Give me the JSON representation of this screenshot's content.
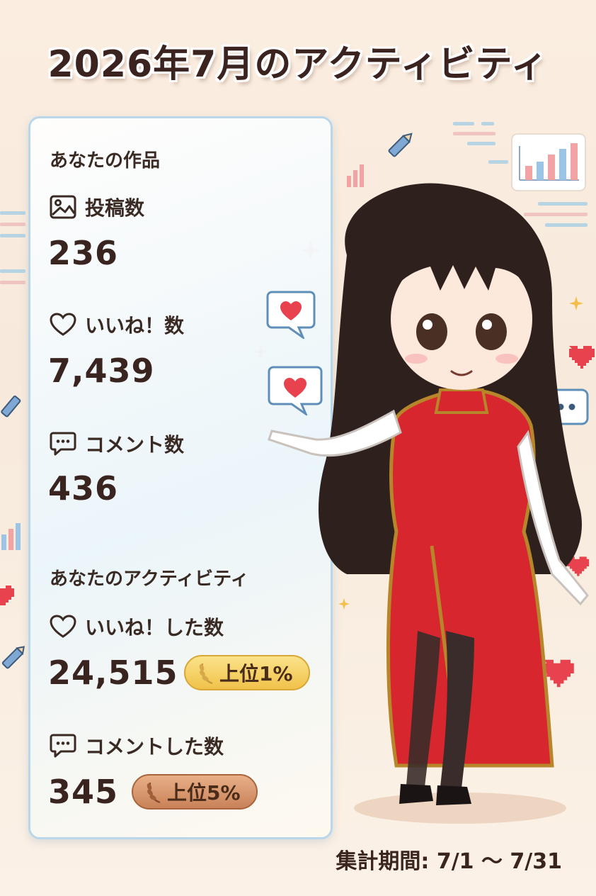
{
  "title": "2026年7月のアクティビティ",
  "works": {
    "heading": "あなたの作品",
    "posts": {
      "label": "投稿数",
      "value": "236",
      "icon": "image-icon"
    },
    "likes": {
      "label": "いいね！数",
      "value": "7,439",
      "icon": "heart-icon"
    },
    "comments": {
      "label": "コメント数",
      "value": "436",
      "icon": "comment-icon"
    }
  },
  "activity": {
    "heading": "あなたのアクティビティ",
    "likes_given": {
      "label": "いいね！した数",
      "value": "24,515",
      "badge": "上位1%",
      "badge_color": "#f0c24a"
    },
    "comments_given": {
      "label": "コメントした数",
      "value": "345",
      "badge": "上位5%",
      "badge_color": "#c98258"
    }
  },
  "period": "集計期間: 7/1 〜 7/31",
  "colors": {
    "accent_heart": "#e8424e",
    "dress_red": "#d8262e",
    "card_border": "#b9d6ea"
  }
}
